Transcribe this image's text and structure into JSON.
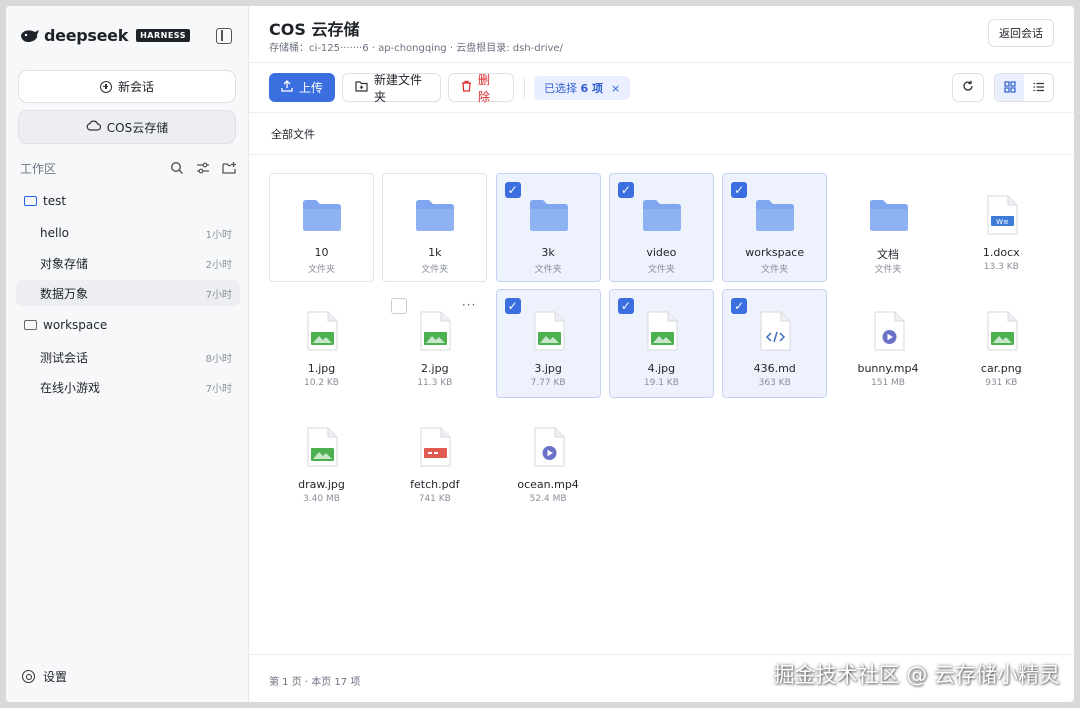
{
  "sidebar": {
    "brand": "deepseek",
    "badge": "HARNESS",
    "new_chat": "新会话",
    "cos": "COS云存储",
    "workspace_label": "工作区",
    "folders": [
      {
        "name": "test",
        "chats": [
          {
            "title": "hello",
            "time": "1小时"
          },
          {
            "title": "对象存储",
            "time": "2小时"
          },
          {
            "title": "数据万象",
            "time": "7小时"
          }
        ]
      },
      {
        "name": "workspace",
        "chats": [
          {
            "title": "测试会话",
            "time": "8小时"
          },
          {
            "title": "在线小游戏",
            "time": "7小时"
          }
        ]
      }
    ],
    "settings": "设置"
  },
  "header": {
    "title": "COS 云存储",
    "subtitle": "存储桶：ci-125·······6 · ap-chongqing · 云盘根目录: dsh-drive/",
    "back": "返回会话"
  },
  "toolbar": {
    "upload": "上传",
    "new_folder": "新建文件夹",
    "delete": "删除",
    "selected_prefix": "已选择",
    "selected_count": "6 项",
    "clear": "×"
  },
  "breadcrumb": "全部文件",
  "files": [
    {
      "name": "10",
      "meta": "文件夹",
      "kind": "folder",
      "selected": false
    },
    {
      "name": "1k",
      "meta": "文件夹",
      "kind": "folder",
      "selected": false
    },
    {
      "name": "3k",
      "meta": "文件夹",
      "kind": "folder",
      "selected": true
    },
    {
      "name": "video",
      "meta": "文件夹",
      "kind": "folder",
      "selected": true
    },
    {
      "name": "workspace",
      "meta": "文件夹",
      "kind": "folder",
      "selected": true
    },
    {
      "name": "文档",
      "meta": "文件夹",
      "kind": "folder",
      "selected": false
    },
    {
      "name": "1.docx",
      "meta": "13.3 KB",
      "kind": "doc",
      "selected": false
    },
    {
      "name": "1.jpg",
      "meta": "10.2 KB",
      "kind": "image",
      "selected": false
    },
    {
      "name": "2.jpg",
      "meta": "11.3 KB",
      "kind": "image",
      "selected": false,
      "hover": true
    },
    {
      "name": "3.jpg",
      "meta": "7.77 KB",
      "kind": "image",
      "selected": true
    },
    {
      "name": "4.jpg",
      "meta": "19.1 KB",
      "kind": "image",
      "selected": true
    },
    {
      "name": "436.md",
      "meta": "363 KB",
      "kind": "code",
      "selected": true
    },
    {
      "name": "bunny.mp4",
      "meta": "151 MB",
      "kind": "video",
      "selected": false
    },
    {
      "name": "car.png",
      "meta": "931 KB",
      "kind": "image",
      "selected": false
    },
    {
      "name": "draw.jpg",
      "meta": "3.40 MB",
      "kind": "image",
      "selected": false
    },
    {
      "name": "fetch.pdf",
      "meta": "741 KB",
      "kind": "pdf",
      "selected": false
    },
    {
      "name": "ocean.mp4",
      "meta": "52.4 MB",
      "kind": "video",
      "selected": false
    }
  ],
  "footer": "第 1 页 · 本页 17 项",
  "watermark": "掘金技术社区 @ 云存储小精灵",
  "colors": {
    "accent": "#3b6fe0",
    "danger": "#dc2626",
    "folder": "#7fa6ee",
    "selected_bg": "#eef2fc"
  }
}
